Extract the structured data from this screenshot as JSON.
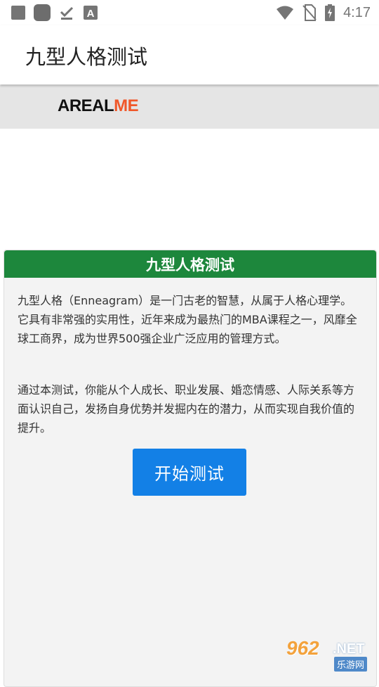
{
  "status_bar": {
    "time": "4:17",
    "icons_left": [
      "square-icon",
      "app-icon",
      "download-done-icon",
      "text-a-icon"
    ],
    "icons_right": [
      "wifi-icon",
      "no-sim-icon",
      "battery-charging-icon"
    ]
  },
  "app_bar": {
    "title": "九型人格测试"
  },
  "brand": {
    "part1": "AREAL",
    "part2": "ME",
    "accent_color": "#f0582a"
  },
  "card": {
    "header": "九型人格测试",
    "header_color": "#1d873c",
    "paragraph1": "九型人格（Enneagram）是一门古老的智慧，从属于人格心理学。它具有非常强的实用性，近年来成为最热门的MBA课程之一，风靡全球工商界，成为世界500强企业广泛应用的管理方式。",
    "paragraph2": "通过本测试，你能从个人成长、职业发展、婚恋情感、人际关系等方面认识自己，发扬自身优势并发掘内在的潜力，从而实现自我价值的提升。",
    "button_label": "开始测试",
    "button_color": "#1380e6"
  },
  "watermark": {
    "number": "962",
    "domain": ".NET",
    "sub": "乐游网"
  }
}
